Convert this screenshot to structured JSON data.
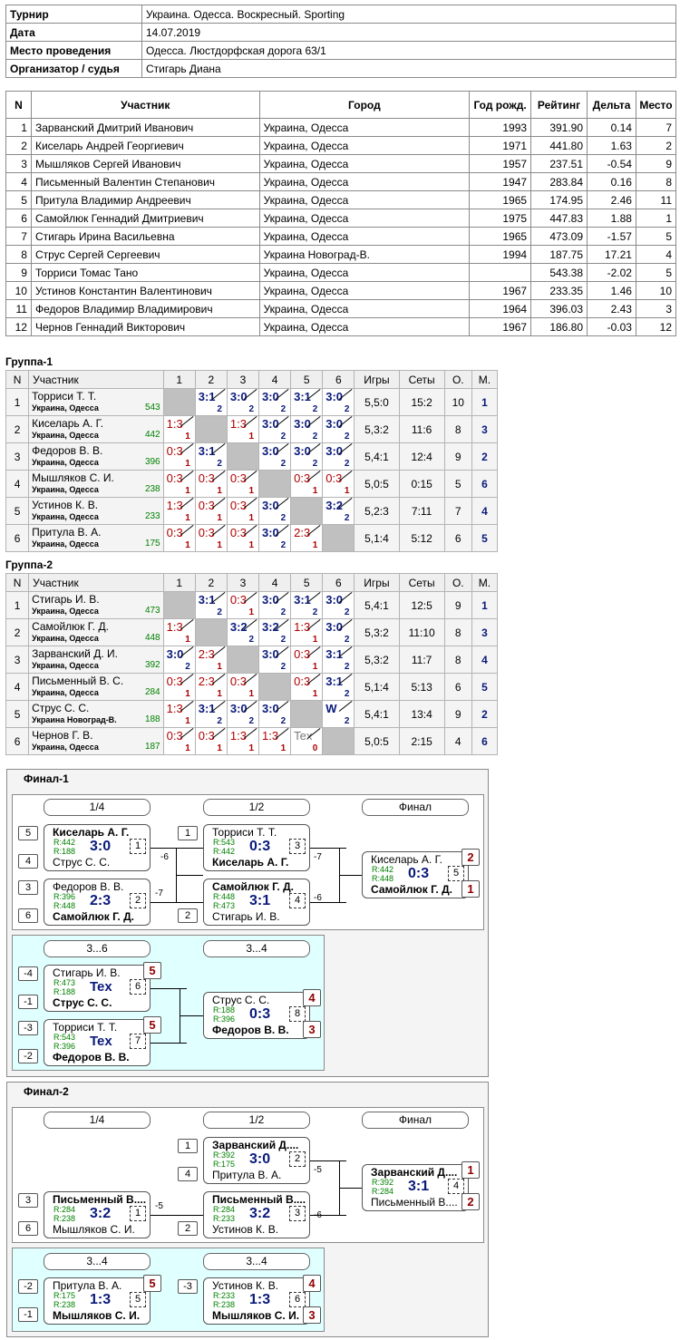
{
  "info": {
    "rows": [
      {
        "k": "Турнир",
        "v": "Украина. Одесса. Воскресный. Sporting"
      },
      {
        "k": "Дата",
        "v": "14.07.2019"
      },
      {
        "k": "Место проведения",
        "v": "Одесса. Люстдорфская дорога 63/1"
      },
      {
        "k": "Организатор / судья",
        "v": "Стигарь Диана"
      }
    ]
  },
  "players": {
    "headers": [
      "N",
      "Участник",
      "Город",
      "Год рожд.",
      "Рейтинг",
      "Дельта",
      "Место"
    ],
    "rows": [
      [
        "1",
        "Зарванский Дмитрий Иванович",
        "Украина, Одесса",
        "1993",
        "391.90",
        "0.14",
        "7"
      ],
      [
        "2",
        "Киселарь Андрей Георгиевич",
        "Украина, Одесса",
        "1971",
        "441.80",
        "1.63",
        "2"
      ],
      [
        "3",
        "Мышляков Сергей Иванович",
        "Украина, Одесса",
        "1957",
        "237.51",
        "-0.54",
        "9"
      ],
      [
        "4",
        "Письменный Валентин Степанович",
        "Украина, Одесса",
        "1947",
        "283.84",
        "0.16",
        "8"
      ],
      [
        "5",
        "Притула Владимир Андреевич",
        "Украина, Одесса",
        "1965",
        "174.95",
        "2.46",
        "11"
      ],
      [
        "6",
        "Самойлюк Геннадий Дмитриевич",
        "Украина, Одесса",
        "1975",
        "447.83",
        "1.88",
        "1"
      ],
      [
        "7",
        "Стигарь Ирина Васильевна",
        "Украина, Одесса",
        "1965",
        "473.09",
        "-1.57",
        "5"
      ],
      [
        "8",
        "Струс Сергей Сергеевич",
        "Украина Новоград-В.",
        "1994",
        "187.75",
        "17.21",
        "4"
      ],
      [
        "9",
        "Торриси Томас Тано",
        "Украина, Одесса",
        "",
        "543.38",
        "-2.02",
        "5"
      ],
      [
        "10",
        "Устинов Константин Валентинович",
        "Украина, Одесса",
        "1967",
        "233.35",
        "1.46",
        "10"
      ],
      [
        "11",
        "Федоров Владимир Владимирович",
        "Украина, Одесса",
        "1964",
        "396.03",
        "2.43",
        "3"
      ],
      [
        "12",
        "Чернов Геннадий Викторович",
        "Украина, Одесса",
        "1967",
        "186.80",
        "-0.03",
        "12"
      ]
    ]
  },
  "group_headers": [
    "N",
    "Участник",
    "1",
    "2",
    "3",
    "4",
    "5",
    "6",
    "Игры",
    "Сеты",
    "О.",
    "М."
  ],
  "groups": [
    {
      "title": "Группа-1",
      "rows": [
        {
          "n": "1",
          "name": "Торриси Т. Т.",
          "city": "Украина, Одесса",
          "rating": "543",
          "cells": [
            null,
            [
              "3:1",
              "2"
            ],
            [
              "3:0",
              "2"
            ],
            [
              "3:0",
              "2"
            ],
            [
              "3:1",
              "2"
            ],
            [
              "3:0",
              "2"
            ]
          ],
          "games": "5,5:0",
          "sets": "15:2",
          "pts": "10",
          "place": "1"
        },
        {
          "n": "2",
          "name": "Киселарь А. Г.",
          "city": "Украина, Одесса",
          "rating": "442",
          "cells": [
            [
              "1:3",
              "1"
            ],
            null,
            [
              "1:3",
              "1"
            ],
            [
              "3:0",
              "2"
            ],
            [
              "3:0",
              "2"
            ],
            [
              "3:0",
              "2"
            ]
          ],
          "games": "5,3:2",
          "sets": "11:6",
          "pts": "8",
          "place": "3"
        },
        {
          "n": "3",
          "name": "Федоров В. В.",
          "city": "Украина, Одесса",
          "rating": "396",
          "cells": [
            [
              "0:3",
              "1"
            ],
            [
              "3:1",
              "2"
            ],
            null,
            [
              "3:0",
              "2"
            ],
            [
              "3:0",
              "2"
            ],
            [
              "3:0",
              "2"
            ]
          ],
          "games": "5,4:1",
          "sets": "12:4",
          "pts": "9",
          "place": "2"
        },
        {
          "n": "4",
          "name": "Мышляков С. И.",
          "city": "Украина, Одесса",
          "rating": "238",
          "cells": [
            [
              "0:3",
              "1"
            ],
            [
              "0:3",
              "1"
            ],
            [
              "0:3",
              "1"
            ],
            null,
            [
              "0:3",
              "1"
            ],
            [
              "0:3",
              "1"
            ]
          ],
          "games": "5,0:5",
          "sets": "0:15",
          "pts": "5",
          "place": "6"
        },
        {
          "n": "5",
          "name": "Устинов К. В.",
          "city": "Украина, Одесса",
          "rating": "233",
          "cells": [
            [
              "1:3",
              "1"
            ],
            [
              "0:3",
              "1"
            ],
            [
              "0:3",
              "1"
            ],
            [
              "3:0",
              "2"
            ],
            null,
            [
              "3:2",
              "2"
            ]
          ],
          "games": "5,2:3",
          "sets": "7:11",
          "pts": "7",
          "place": "4"
        },
        {
          "n": "6",
          "name": "Притула В. А.",
          "city": "Украина, Одесса",
          "rating": "175",
          "cells": [
            [
              "0:3",
              "1"
            ],
            [
              "0:3",
              "1"
            ],
            [
              "0:3",
              "1"
            ],
            [
              "3:0",
              "2"
            ],
            [
              "2:3",
              "1"
            ],
            null
          ],
          "games": "5,1:4",
          "sets": "5:12",
          "pts": "6",
          "place": "5"
        }
      ]
    },
    {
      "title": "Группа-2",
      "rows": [
        {
          "n": "1",
          "name": "Стигарь И. В.",
          "city": "Украина, Одесса",
          "rating": "473",
          "cells": [
            null,
            [
              "3:1",
              "2"
            ],
            [
              "0:3",
              "1"
            ],
            [
              "3:0",
              "2"
            ],
            [
              "3:1",
              "2"
            ],
            [
              "3:0",
              "2"
            ]
          ],
          "games": "5,4:1",
          "sets": "12:5",
          "pts": "9",
          "place": "1"
        },
        {
          "n": "2",
          "name": "Самойлюк Г. Д.",
          "city": "Украина, Одесса",
          "rating": "448",
          "cells": [
            [
              "1:3",
              "1"
            ],
            null,
            [
              "3:2",
              "2"
            ],
            [
              "3:2",
              "2"
            ],
            [
              "1:3",
              "1"
            ],
            [
              "3:0",
              "2"
            ]
          ],
          "games": "5,3:2",
          "sets": "11:10",
          "pts": "8",
          "place": "3"
        },
        {
          "n": "3",
          "name": "Зарванский Д. И.",
          "city": "Украина, Одесса",
          "rating": "392",
          "cells": [
            [
              "3:0",
              "2"
            ],
            [
              "2:3",
              "1"
            ],
            null,
            [
              "3:0",
              "2"
            ],
            [
              "0:3",
              "1"
            ],
            [
              "3:1",
              "2"
            ]
          ],
          "games": "5,3:2",
          "sets": "11:7",
          "pts": "8",
          "place": "4"
        },
        {
          "n": "4",
          "name": "Письменный В. С.",
          "city": "Украина, Одесса",
          "rating": "284",
          "cells": [
            [
              "0:3",
              "1"
            ],
            [
              "2:3",
              "1"
            ],
            [
              "0:3",
              "1"
            ],
            null,
            [
              "0:3",
              "1"
            ],
            [
              "3:1",
              "2"
            ]
          ],
          "games": "5,1:4",
          "sets": "5:13",
          "pts": "6",
          "place": "5"
        },
        {
          "n": "5",
          "name": "Струс С. С.",
          "city": "Украина Новоград-В.",
          "rating": "188",
          "cells": [
            [
              "1:3",
              "1"
            ],
            [
              "3:1",
              "2"
            ],
            [
              "3:0",
              "2"
            ],
            [
              "3:0",
              "2"
            ],
            null,
            [
              "W",
              "2"
            ]
          ],
          "games": "5,4:1",
          "sets": "13:4",
          "pts": "9",
          "place": "2"
        },
        {
          "n": "6",
          "name": "Чернов Г. В.",
          "city": "Украина, Одесса",
          "rating": "187",
          "cells": [
            [
              "0:3",
              "1"
            ],
            [
              "0:3",
              "1"
            ],
            [
              "1:3",
              "1"
            ],
            [
              "1:3",
              "1"
            ],
            [
              "Tex",
              "0"
            ],
            null
          ],
          "games": "5,0:5",
          "sets": "2:15",
          "pts": "4",
          "place": "6"
        }
      ]
    }
  ],
  "finals": [
    {
      "title": "Финал-1",
      "rounds": [
        "1/4",
        "1/2",
        "Финал"
      ],
      "consolation_rounds": [
        "3...6",
        "3...4"
      ],
      "matches": [
        {
          "id": "f1q1",
          "p1": "Киселарь А. Г.",
          "p2": "Струс С. С.",
          "r1": "R:442",
          "r2": "R:188",
          "score": "3:0",
          "no": "1",
          "winner": 1,
          "seed1": "5",
          "seed2": "4",
          "loser_to": "-6"
        },
        {
          "id": "f1q2",
          "p1": "Федоров В. В.",
          "p2": "Самойлюк Г. Д.",
          "r1": "R:396",
          "r2": "R:448",
          "score": "2:3",
          "no": "2",
          "winner": 2,
          "seed1": "3",
          "seed2": "6",
          "loser_to": "-7"
        },
        {
          "id": "f1s1",
          "p1": "Торриси Т. Т.",
          "p2": "Киселарь А. Г.",
          "r1": "R:543",
          "r2": "R:442",
          "score": "0:3",
          "no": "3",
          "winner": 2,
          "seed1": "1",
          "loser_to": "-7"
        },
        {
          "id": "f1s2",
          "p1": "Самойлюк Г. Д.",
          "p2": "Стигарь И. В.",
          "r1": "R:448",
          "r2": "R:473",
          "score": "3:1",
          "no": "4",
          "winner": 1,
          "seed2": "2",
          "loser_to": "-6"
        },
        {
          "id": "f1f",
          "p1": "Киселарь А. Г.",
          "p2": "Самойлюк Г. Д.",
          "r1": "R:442",
          "r2": "R:448",
          "score": "0:3",
          "no": "5",
          "winner": 2,
          "place1": "2",
          "place2": "1"
        },
        {
          "id": "f1c1",
          "p1": "Стигарь И. В.",
          "p2": "Струс С. С.",
          "r1": "R:473",
          "r2": "R:188",
          "score": "Tex",
          "no": "6",
          "winner": 2,
          "seed1": "-4",
          "seed2": "-1",
          "place1": "5"
        },
        {
          "id": "f1c2",
          "p1": "Торриси Т. Т.",
          "p2": "Федоров В. В.",
          "r1": "R:543",
          "r2": "R:396",
          "score": "Tex",
          "no": "7",
          "winner": 2,
          "seed1": "-3",
          "seed2": "-2",
          "place1": "5"
        },
        {
          "id": "f1c3",
          "p1": "Струс С. С.",
          "p2": "Федоров В. В.",
          "r1": "R:188",
          "r2": "R:396",
          "score": "0:3",
          "no": "8",
          "winner": 2,
          "place1": "4",
          "place2": "3"
        }
      ]
    },
    {
      "title": "Финал-2",
      "rounds": [
        "1/4",
        "1/2",
        "Финал"
      ],
      "consolation_rounds": [
        "3...4",
        "3...4"
      ],
      "matches": [
        {
          "id": "f2s1",
          "p1": "Зарванский Д....",
          "p2": "Притула В. А.",
          "r1": "R:392",
          "r2": "R:175",
          "score": "3:0",
          "no": "2",
          "winner": 1,
          "seed1": "1",
          "seed2": "4",
          "loser_to": "-5"
        },
        {
          "id": "f2q1",
          "p1": "Письменный В....",
          "p2": "Мышляков С. И.",
          "r1": "R:284",
          "r2": "R:238",
          "score": "3:2",
          "no": "1",
          "winner": 1,
          "seed1": "3",
          "seed2": "6",
          "loser_to": "-5"
        },
        {
          "id": "f2s2",
          "p1": "Письменный В....",
          "p2": "Устинов К. В.",
          "r1": "R:284",
          "r2": "R:233",
          "score": "3:2",
          "no": "3",
          "winner": 1,
          "seed2": "2",
          "loser_to": "-6"
        },
        {
          "id": "f2f",
          "p1": "Зарванский Д....",
          "p2": "Письменный В....",
          "r1": "R:392",
          "r2": "R:284",
          "score": "3:1",
          "no": "4",
          "winner": 1,
          "place1": "1",
          "place2": "2"
        },
        {
          "id": "f2c1",
          "p1": "Притула В. А.",
          "p2": "Мышляков С. И.",
          "r1": "R:175",
          "r2": "R:238",
          "score": "1:3",
          "no": "5",
          "winner": 2,
          "seed1": "-2",
          "seed2": "-1",
          "place1": "5"
        },
        {
          "id": "f2c2",
          "p1": "Устинов К. В.",
          "p2": "Мышляков С. И.",
          "r1": "R:233",
          "r2": "R:238",
          "score": "1:3",
          "no": "6",
          "winner": 2,
          "seed1": "-3",
          "place1": "4",
          "place2": "3"
        }
      ]
    }
  ],
  "colors": {
    "winner_score": "#0a1a7a",
    "loser_score": "#b00000",
    "rating": "#008000",
    "place": "#900000",
    "consolation_bg": "#e0ffff"
  }
}
